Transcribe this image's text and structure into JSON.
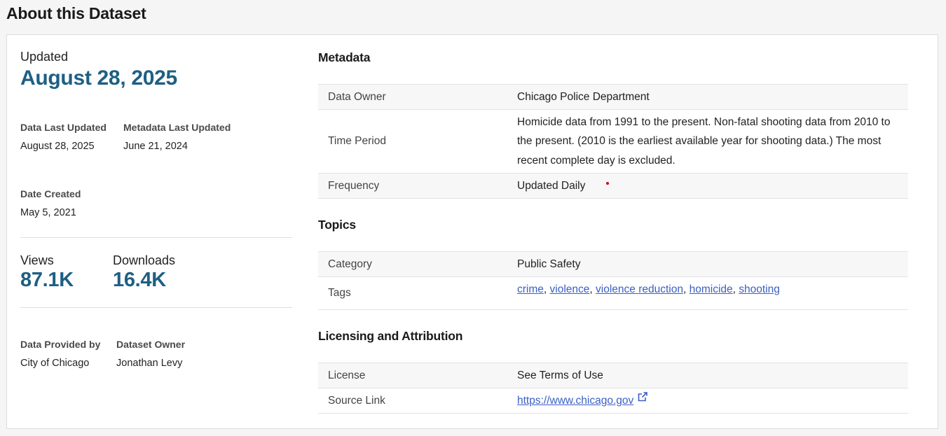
{
  "page": {
    "title": "About this Dataset"
  },
  "summary": {
    "updated_label": "Updated",
    "updated_date": "August 28, 2025",
    "data_last_updated_label": "Data Last Updated",
    "data_last_updated_value": "August 28, 2025",
    "metadata_last_updated_label": "Metadata Last Updated",
    "metadata_last_updated_value": "June 21, 2024",
    "date_created_label": "Date Created",
    "date_created_value": "May 5, 2021",
    "views_label": "Views",
    "views_value": "87.1K",
    "downloads_label": "Downloads",
    "downloads_value": "16.4K",
    "provided_by_label": "Data Provided by",
    "provided_by_value": "City of Chicago",
    "dataset_owner_label": "Dataset Owner",
    "dataset_owner_value": "Jonathan Levy"
  },
  "metadata": {
    "title": "Metadata",
    "data_owner_key": "Data Owner",
    "data_owner_value": "Chicago Police Department",
    "time_period_key": "Time Period",
    "time_period_value": "Homicide data from 1991 to the present. Non-fatal shooting data from 2010 to the present. (2010 is the earliest available year for shooting data.) The most recent complete day is excluded.",
    "frequency_key": "Frequency",
    "frequency_value": "Updated Daily"
  },
  "topics": {
    "title": "Topics",
    "category_key": "Category",
    "category_value": "Public Safety",
    "tags_key": "Tags",
    "tags": [
      "crime",
      "violence",
      "violence reduction",
      "homicide",
      "shooting"
    ]
  },
  "licensing": {
    "title": "Licensing and Attribution",
    "license_key": "License",
    "license_value": "See Terms of Use",
    "source_link_key": "Source Link",
    "source_link_value": "https://www.chicago.gov"
  },
  "colors": {
    "accent": "#1e5f83",
    "link": "#3b5fc4",
    "dot": "#d0021b"
  },
  "icons": {
    "external": "external-link-icon"
  }
}
